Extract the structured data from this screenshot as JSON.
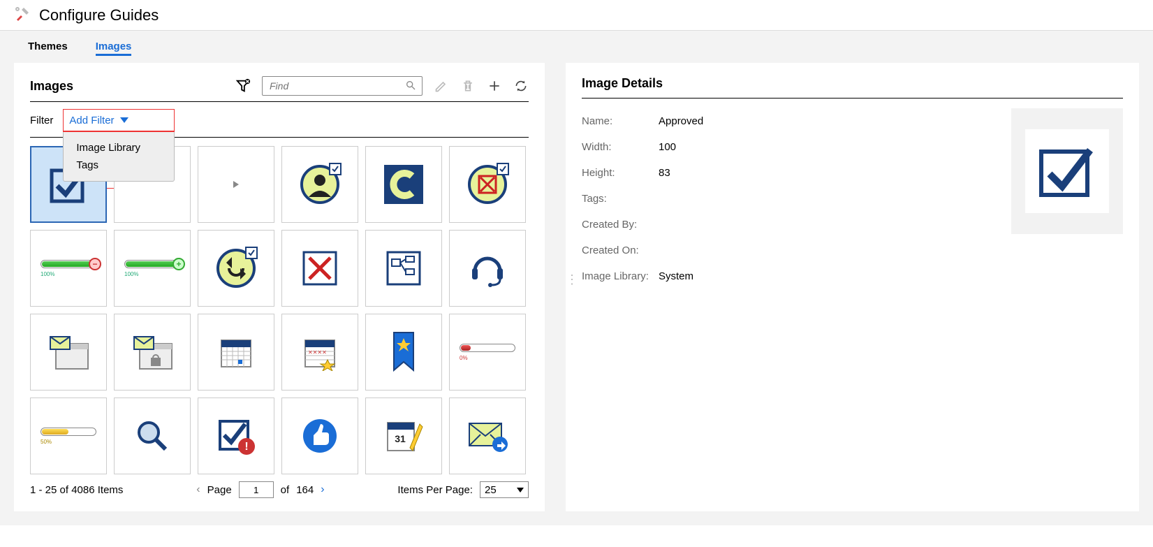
{
  "app": {
    "title": "Configure Guides"
  },
  "tabs": {
    "themes": "Themes",
    "images": "Images",
    "active": "images"
  },
  "left_panel": {
    "title": "Images",
    "search_placeholder": "Find",
    "filter_label": "Filter",
    "add_filter_label": "Add Filter",
    "filter_options": [
      "Image Library",
      "Tags"
    ]
  },
  "grid": {
    "items": [
      {
        "id": "approved",
        "type": "checkbox-blue",
        "selected": true
      },
      {
        "id": "blank",
        "type": "blank"
      },
      {
        "id": "play",
        "type": "play-triangle"
      },
      {
        "id": "avatar-check",
        "type": "avatar-circle-check"
      },
      {
        "id": "c-logo",
        "type": "c-logo"
      },
      {
        "id": "x-circle-check",
        "type": "red-x-circle-check"
      },
      {
        "id": "battery-minus",
        "type": "battery-minus",
        "pct": "100%"
      },
      {
        "id": "battery-plus",
        "type": "battery-plus",
        "pct": "100%"
      },
      {
        "id": "arrows-circle-check",
        "type": "arrows-circle-check"
      },
      {
        "id": "red-x-box",
        "type": "red-x-box"
      },
      {
        "id": "flowchart",
        "type": "flowchart"
      },
      {
        "id": "headset",
        "type": "headset"
      },
      {
        "id": "mail-window",
        "type": "mail-window"
      },
      {
        "id": "mail-lock",
        "type": "mail-lock"
      },
      {
        "id": "calendar-dot",
        "type": "calendar-dot"
      },
      {
        "id": "calendar-star",
        "type": "calendar-star"
      },
      {
        "id": "bookmark-star",
        "type": "bookmark-star"
      },
      {
        "id": "battery-red",
        "type": "battery-red",
        "pct": "0%"
      },
      {
        "id": "battery-yellow",
        "type": "battery-yellow",
        "pct": "50%"
      },
      {
        "id": "magnifier",
        "type": "magnifier"
      },
      {
        "id": "check-alert",
        "type": "check-alert"
      },
      {
        "id": "thumbs-up",
        "type": "thumbs-up"
      },
      {
        "id": "calendar-edit",
        "type": "calendar-edit",
        "day": "31"
      },
      {
        "id": "mail-forward",
        "type": "mail-forward"
      }
    ]
  },
  "pager": {
    "range_text": "1 - 25 of 4086 Items",
    "page_label": "Page",
    "page": "1",
    "of_label": "of",
    "total_pages": "164",
    "ipp_label": "Items Per Page:",
    "ipp": "25"
  },
  "details": {
    "title": "Image Details",
    "labels": {
      "name": "Name:",
      "width": "Width:",
      "height": "Height:",
      "tags": "Tags:",
      "created_by": "Created By:",
      "created_on": "Created On:",
      "library": "Image Library:"
    },
    "values": {
      "name": "Approved",
      "width": "100",
      "height": "83",
      "tags": "",
      "created_by": "",
      "created_on": "",
      "library": "System"
    }
  }
}
